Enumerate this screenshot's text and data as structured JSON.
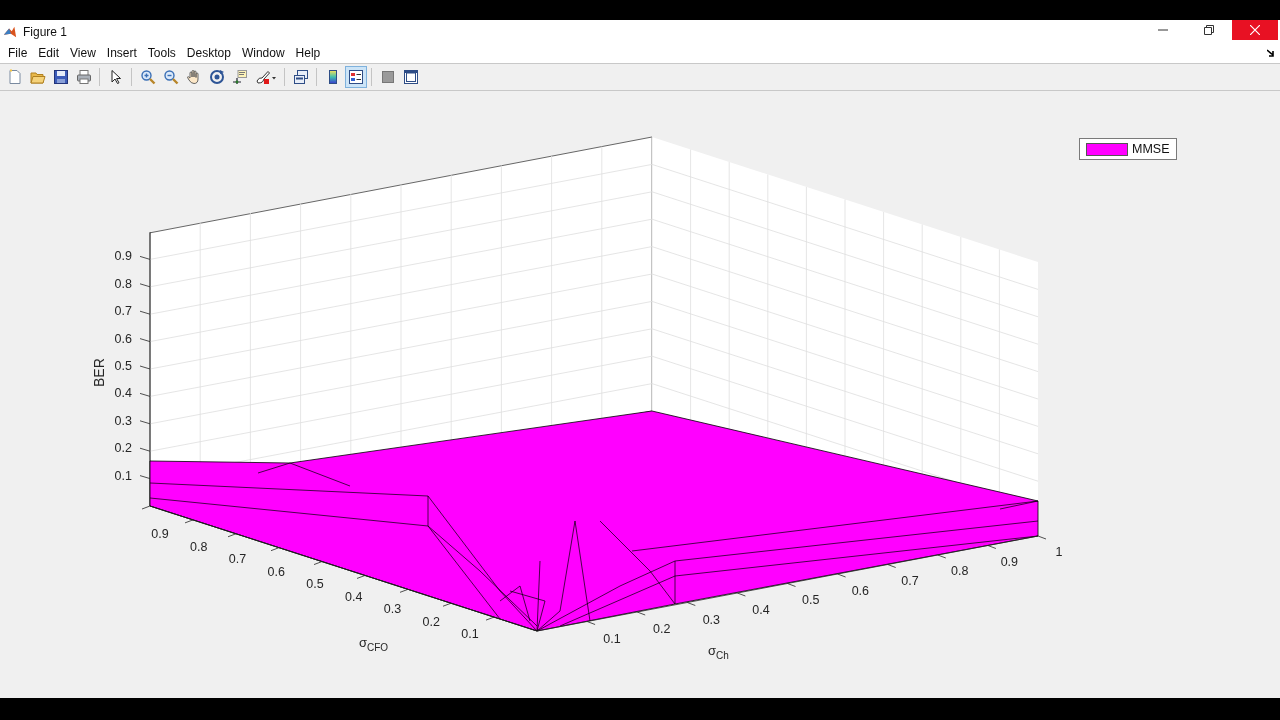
{
  "window": {
    "title": "Figure 1"
  },
  "menu": [
    "File",
    "Edit",
    "View",
    "Insert",
    "Tools",
    "Desktop",
    "Window",
    "Help"
  ],
  "toolbar": [
    [
      {
        "kind": "new",
        "selected": false
      },
      {
        "kind": "open",
        "selected": false
      },
      {
        "kind": "save",
        "selected": false
      },
      {
        "kind": "print",
        "selected": false
      }
    ],
    [
      {
        "kind": "pointer",
        "selected": false
      }
    ],
    [
      {
        "kind": "zoom-in",
        "selected": false
      },
      {
        "kind": "zoom-out",
        "selected": false
      },
      {
        "kind": "pan",
        "selected": false
      },
      {
        "kind": "rotate",
        "selected": false
      },
      {
        "kind": "datatip",
        "selected": false
      },
      {
        "kind": "brush",
        "selected": false
      }
    ],
    [
      {
        "kind": "link",
        "selected": false
      }
    ],
    [
      {
        "kind": "colorbar",
        "selected": false
      },
      {
        "kind": "legend",
        "selected": true
      }
    ],
    [
      {
        "kind": "hide",
        "selected": false
      },
      {
        "kind": "dock",
        "selected": false
      }
    ]
  ],
  "legend": {
    "label": "MMSE",
    "color": "#ff00ff"
  },
  "axes": {
    "z_label": "BER",
    "z_ticks": [
      "0.9",
      "0.8",
      "0.7",
      "0.6",
      "0.5",
      "0.4",
      "0.3",
      "0.2",
      "0.1"
    ],
    "x_label": "σ$_{CFO}$",
    "x_ticks": [
      "0.9",
      "0.8",
      "0.7",
      "0.6",
      "0.5",
      "0.4",
      "0.3",
      "0.2",
      "0.1"
    ],
    "y_label": "σ$_{Ch}$",
    "y_ticks": [
      "0.1",
      "0.2",
      "0.3",
      "0.4",
      "0.5",
      "0.6",
      "0.7",
      "0.8",
      "0.9",
      "1"
    ]
  }
}
